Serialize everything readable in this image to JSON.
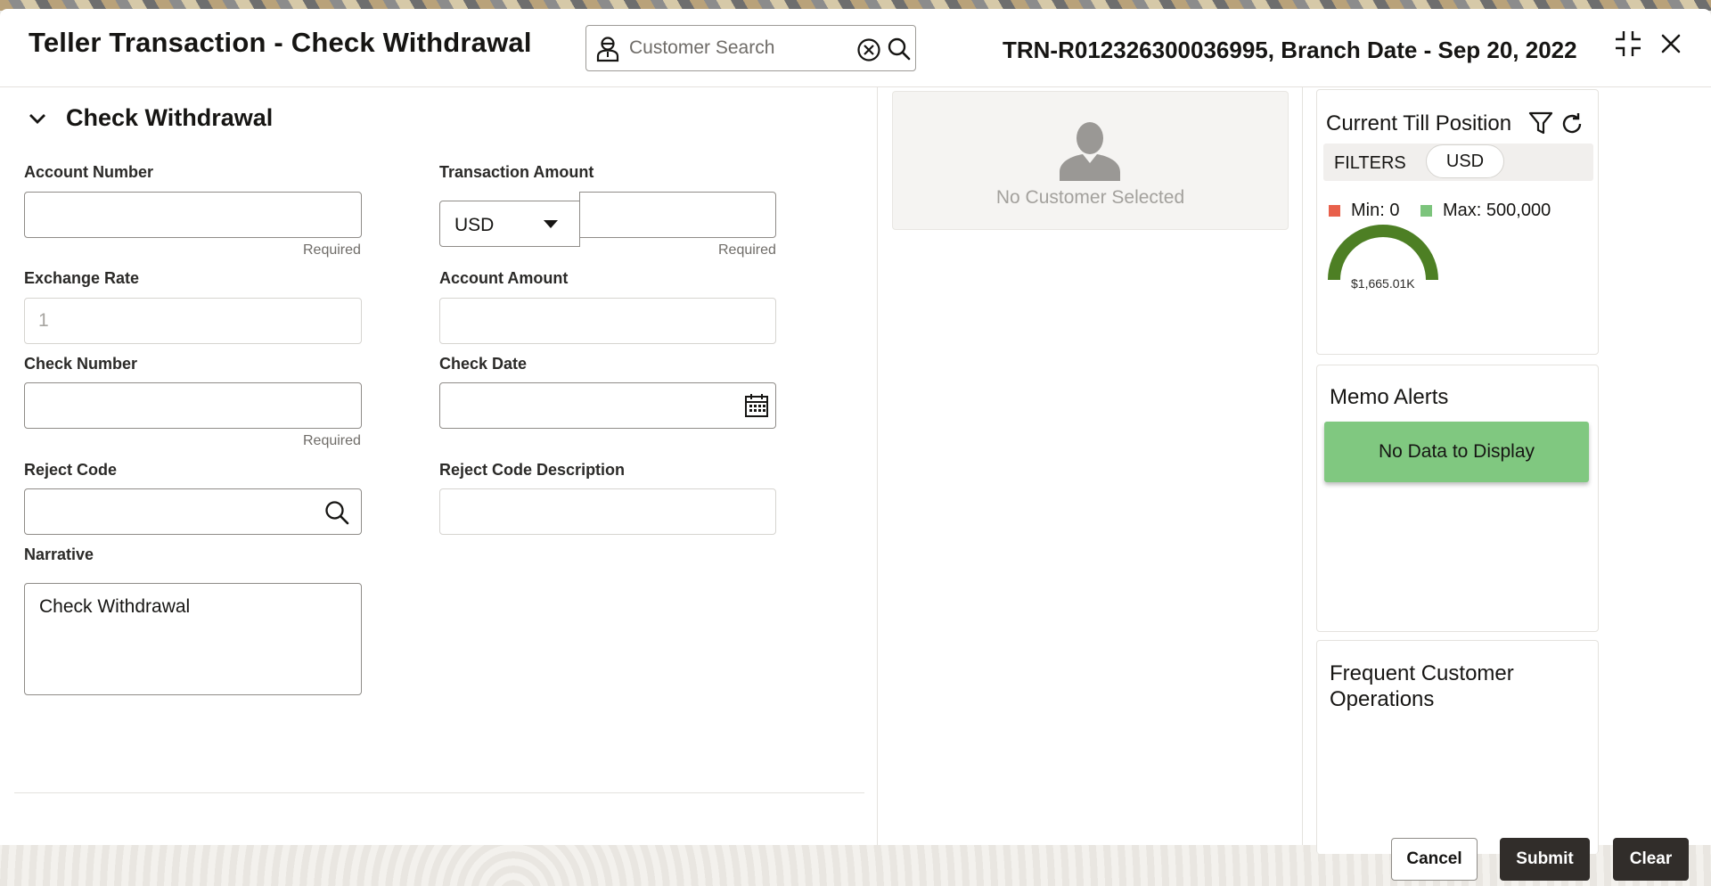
{
  "header": {
    "title": "Teller Transaction - Check Withdrawal",
    "search_placeholder": "Customer Search",
    "transaction_info": "TRN-R012326300036995, Branch Date - Sep 20, 2022"
  },
  "section": {
    "title": "Check Withdrawal"
  },
  "form": {
    "account_number": {
      "label": "Account Number",
      "value": "",
      "hint": "Required"
    },
    "transaction_amount": {
      "label": "Transaction Amount",
      "currency": "USD",
      "value": "",
      "hint": "Required"
    },
    "exchange_rate": {
      "label": "Exchange Rate",
      "value": "1"
    },
    "account_amount": {
      "label": "Account Amount",
      "value": ""
    },
    "check_number": {
      "label": "Check Number",
      "value": "",
      "hint": "Required"
    },
    "check_date": {
      "label": "Check Date",
      "value": ""
    },
    "reject_code": {
      "label": "Reject Code",
      "value": ""
    },
    "reject_code_description": {
      "label": "Reject Code Description",
      "value": ""
    },
    "narrative": {
      "label": "Narrative",
      "value": "Check Withdrawal"
    }
  },
  "customer_card": {
    "text": "No Customer Selected"
  },
  "till_position": {
    "title": "Current Till Position",
    "filters_label": "FILTERS",
    "filter_chip": "USD",
    "min_label": "Min: 0",
    "max_label": "Max: 500,000",
    "gauge_value": "$1,665.01K",
    "colors": {
      "min": "#e8604b",
      "max": "#7cc47c",
      "gauge": "#4d7f24"
    }
  },
  "memo_alerts": {
    "title": "Memo Alerts",
    "empty_text": "No Data to Display"
  },
  "frequent_ops": {
    "title": "Frequent Customer Operations"
  },
  "footer": {
    "cancel": "Cancel",
    "submit": "Submit",
    "clear": "Clear"
  }
}
